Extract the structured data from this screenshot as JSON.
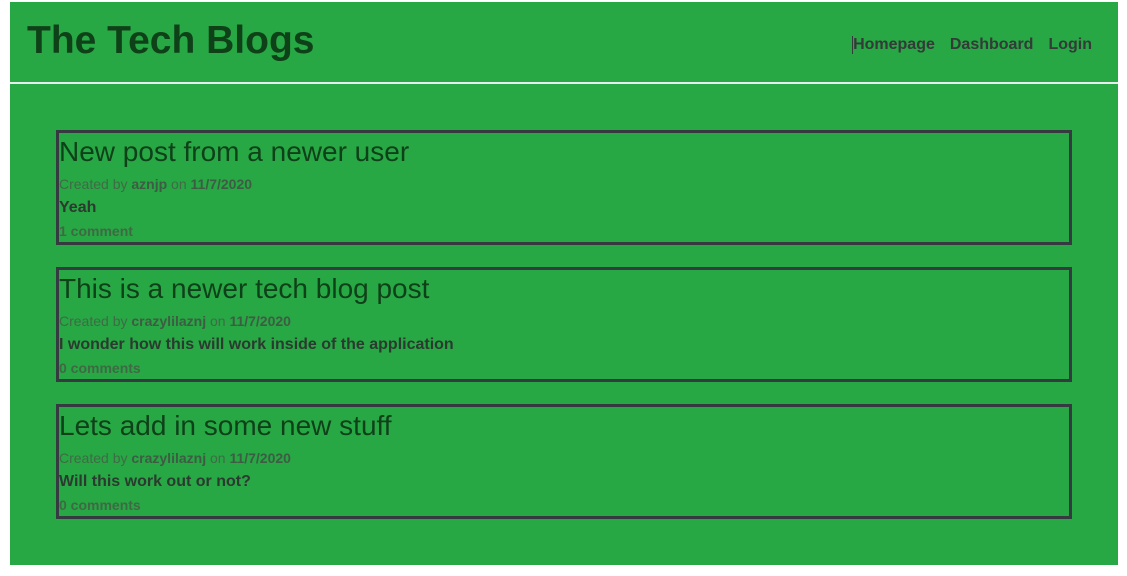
{
  "header": {
    "title": "The Tech Blogs",
    "nav": [
      {
        "label": "Homepage"
      },
      {
        "label": "Dashboard"
      },
      {
        "label": "Login"
      }
    ]
  },
  "meta_labels": {
    "created_by": "Created by",
    "on": "on"
  },
  "posts": [
    {
      "title": "New post from a newer user",
      "author": "aznjp",
      "date": "11/7/2020",
      "body": "Yeah",
      "comments": "1 comment"
    },
    {
      "title": "This is a newer tech blog post",
      "author": "crazylilaznj",
      "date": "11/7/2020",
      "body": "I wonder how this will work inside of the application",
      "comments": "0 comments"
    },
    {
      "title": "Lets add in some new stuff",
      "author": "crazylilaznj",
      "date": "11/7/2020",
      "body": "Will this work out or not?",
      "comments": "0 comments"
    }
  ],
  "colors": {
    "background": "#28a745",
    "title": "#0f4119",
    "border": "#343a40"
  }
}
